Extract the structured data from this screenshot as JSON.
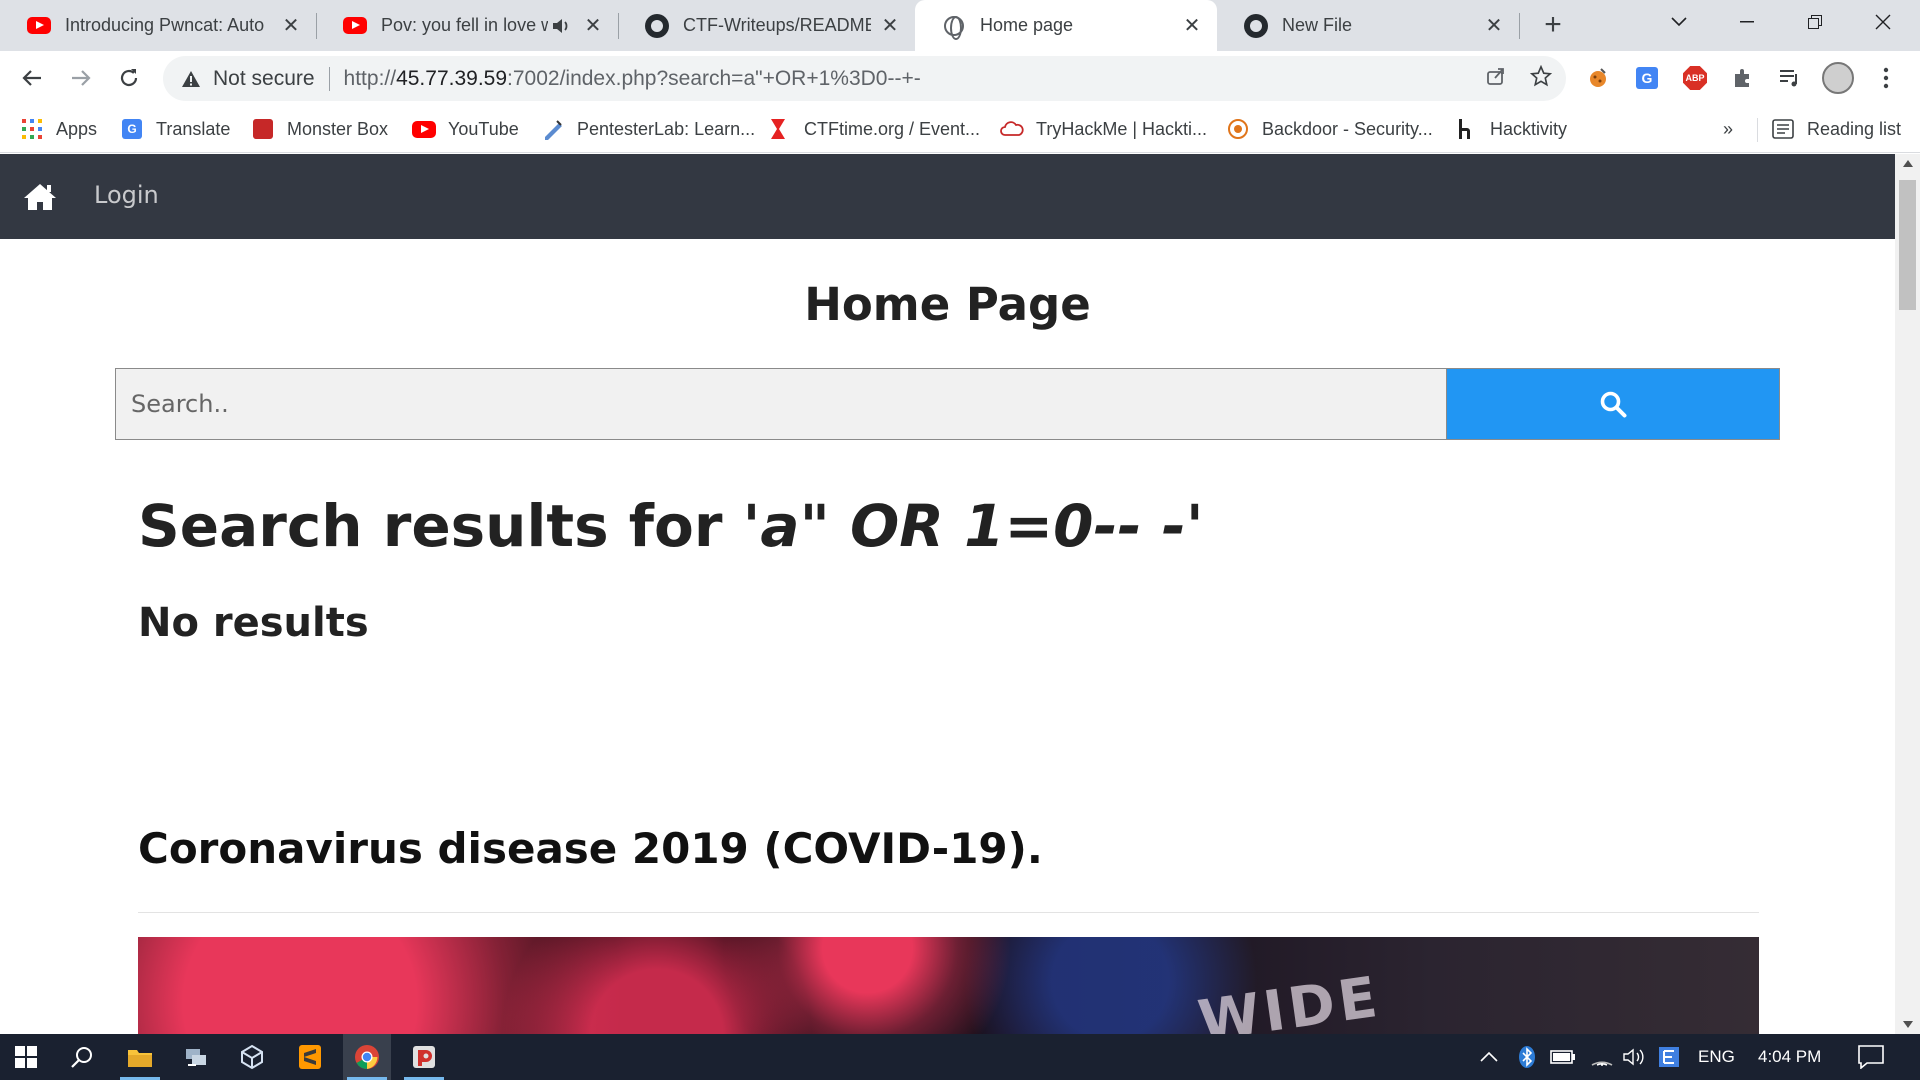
{
  "browser": {
    "tabs": [
      {
        "title": "Introducing Pwncat: Auto",
        "icon": "youtube-icon"
      },
      {
        "title": "Pov: you fell in love w",
        "icon": "youtube-icon",
        "muted_icon": "speaker-icon"
      },
      {
        "title": "CTF-Writeups/README.m",
        "icon": "github-icon"
      },
      {
        "title": "Home page",
        "icon": "globe-icon",
        "active": true
      },
      {
        "title": "New File",
        "icon": "github-icon"
      }
    ],
    "close_glyph": "✕",
    "new_tab_glyph": "+",
    "security_label": "Not secure",
    "url_scheme": "http://",
    "url_host": "45.77.39.59",
    "url_rest": ":7002/index.php?search=a\"+OR+1%3D0--+-",
    "reading_list_label": "Reading list",
    "bookmarks_overflow": "»"
  },
  "bookmarks": [
    {
      "label": "Apps",
      "icon": "apps-grid-icon"
    },
    {
      "label": "Translate",
      "icon": "google-translate-icon"
    },
    {
      "label": "Monster Box",
      "icon": "monster-box-icon"
    },
    {
      "label": "YouTube",
      "icon": "youtube-icon"
    },
    {
      "label": "PentesterLab: Learn...",
      "icon": "pentesterlab-icon"
    },
    {
      "label": "CTFtime.org / Event...",
      "icon": "ctftime-icon"
    },
    {
      "label": "TryHackMe | Hackti...",
      "icon": "tryhackme-icon"
    },
    {
      "label": "Backdoor - Security...",
      "icon": "backdoor-icon"
    },
    {
      "label": "Hacktivity",
      "icon": "hackerone-icon"
    }
  ],
  "site": {
    "nav_login": "Login",
    "page_title": "Home Page",
    "search_placeholder": "Search..",
    "results_prefix": "Search results for ",
    "results_query": "'a\" OR 1=0-- -'",
    "no_results": "No results",
    "article_title": "Coronavirus disease 2019 (COVID-19).",
    "image_overlay_text": "WIDE",
    "accent_color": "#2196f3",
    "nav_color": "#333842"
  },
  "taskbar": {
    "language": "ENG",
    "time": "4:04 PM",
    "apps": [
      "start-icon",
      "search-icon",
      "file-explorer-icon",
      "network-tool-icon",
      "virtualbox-icon",
      "sublime-text-icon",
      "chrome-icon",
      "burp-icon"
    ]
  }
}
